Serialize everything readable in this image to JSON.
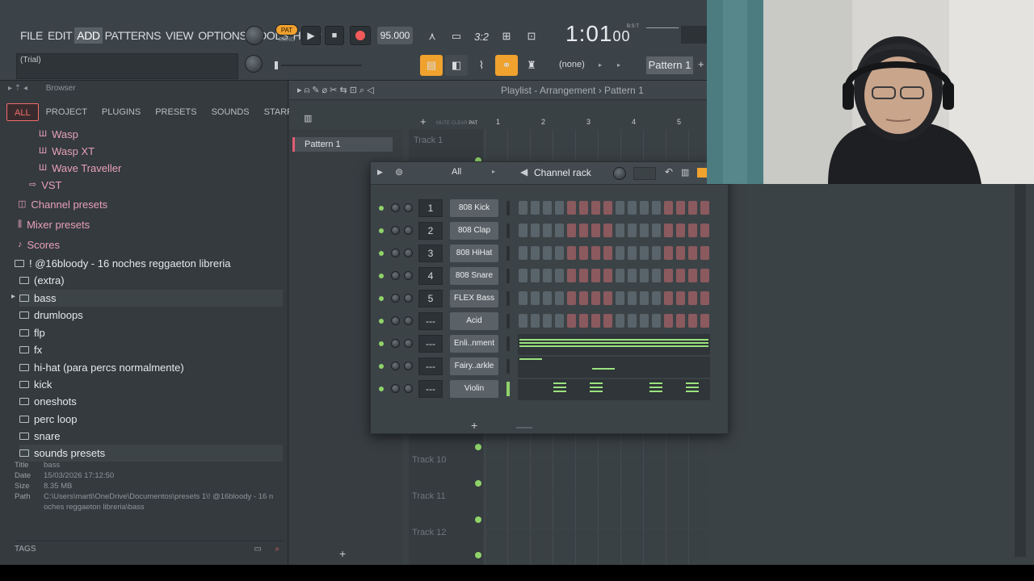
{
  "menu": [
    "FILE",
    "EDIT",
    "ADD",
    "PATTERNS",
    "VIEW",
    "OPTIONS",
    "TOOLS",
    "HELP"
  ],
  "hint": "(Trial)",
  "pat_label": "PAT",
  "song_label": "SONG",
  "tempo": "95.000",
  "time": "1:01",
  "time_ticks": "00",
  "time_unit": "B:S:T",
  "none_label": "(none)",
  "pattern_label": "Pattern 1",
  "browser": {
    "title": "Browser",
    "tabs": [
      "ALL",
      "PROJECT",
      "PLUGINS",
      "PRESETS",
      "SOUNDS",
      "STARRED"
    ],
    "items": [
      {
        "label": "Wasp",
        "kind": "plugin"
      },
      {
        "label": "Wasp XT",
        "kind": "plugin"
      },
      {
        "label": "Wave Traveller",
        "kind": "plugin"
      },
      {
        "label": "VST",
        "kind": "pink"
      },
      {
        "label": "Channel presets",
        "kind": "pink"
      },
      {
        "label": "Mixer presets",
        "kind": "pink"
      },
      {
        "label": "Scores",
        "kind": "pink"
      },
      {
        "label": "! @16bloody - 16 noches reggaeton libreria",
        "kind": "folder"
      },
      {
        "label": "(extra)",
        "kind": "folder"
      },
      {
        "label": "bass",
        "kind": "folder"
      },
      {
        "label": "drumloops",
        "kind": "folder"
      },
      {
        "label": "flp",
        "kind": "folder"
      },
      {
        "label": "fx",
        "kind": "folder"
      },
      {
        "label": "hi-hat (para percs normalmente)",
        "kind": "folder"
      },
      {
        "label": "kick",
        "kind": "folder"
      },
      {
        "label": "oneshots",
        "kind": "folder"
      },
      {
        "label": "perc loop",
        "kind": "folder"
      },
      {
        "label": "snare",
        "kind": "folder"
      },
      {
        "label": "sounds presets",
        "kind": "folder"
      }
    ],
    "info": {
      "title_label": "Title",
      "title": "bass",
      "date_label": "Date",
      "date": "15/03/2026 17:12:50",
      "size_label": "Size",
      "size": "8.35 MB",
      "path_label": "Path",
      "path": "C:\\Users\\marti\\OneDrive\\Documentos\\presets 1\\! @16bloody - 16 noches reggaeton libreria\\bass"
    },
    "tags": "TAGS"
  },
  "playlist": {
    "breadcrumb": "Playlist - Arrangement › Pattern 1",
    "pattern": "Pattern 1",
    "bars": [
      "1",
      "2",
      "3",
      "4",
      "5"
    ],
    "tracks": [
      "Track 1",
      "Track 10",
      "Track 11",
      "Track 12"
    ],
    "mute_labels": [
      "MUTE",
      "CLEAR",
      "PAT"
    ]
  },
  "rack": {
    "title": "Channel rack",
    "filter": "All",
    "channels": [
      {
        "num": "1",
        "name": "808 Kick"
      },
      {
        "num": "2",
        "name": "808 Clap"
      },
      {
        "num": "3",
        "name": "808 HiHat"
      },
      {
        "num": "4",
        "name": "808 Snare"
      },
      {
        "num": "5",
        "name": "FLEX Bass"
      },
      {
        "num": "---",
        "name": "Acid"
      },
      {
        "num": "---",
        "name": "Enli..nment"
      },
      {
        "num": "---",
        "name": "Fairy..arkle"
      },
      {
        "num": "---",
        "name": "Violin"
      }
    ],
    "add": "+"
  },
  "colors": {
    "accent": "#f0a22e",
    "browser_pink": "#e8a0b8",
    "green": "#8fd36a"
  }
}
